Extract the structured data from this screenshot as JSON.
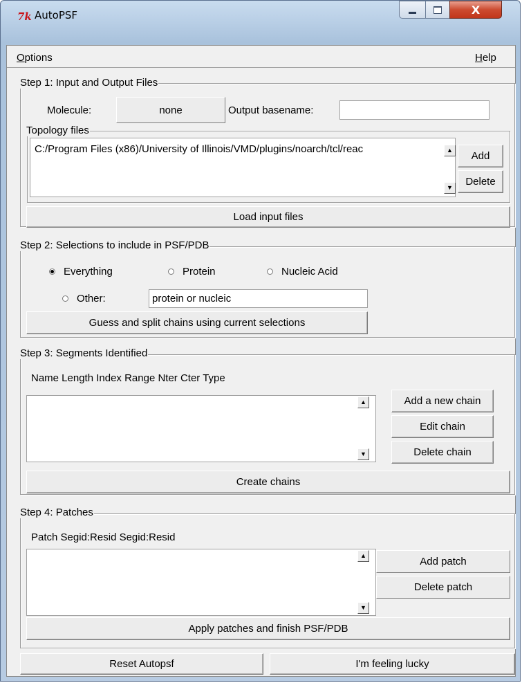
{
  "window": {
    "title": "AutoPSF",
    "icon_symbol": "7k",
    "close_glyph": "X"
  },
  "menu": {
    "options_underline": "O",
    "options_rest": "ptions",
    "help_underline": "H",
    "help_rest": "elp"
  },
  "step1": {
    "title": "Step 1: Input and Output Files",
    "molecule_label": "Molecule:",
    "molecule_value": "none",
    "output_label": "Output basename:",
    "output_value": "",
    "topology_title": "Topology files",
    "topology_files": [
      "C:/Program Files (x86)/University of Illinois/VMD/plugins/noarch/tcl/reac"
    ],
    "add_label": "Add",
    "delete_label": "Delete",
    "load_label": "Load input files"
  },
  "step2": {
    "title": "Step 2: Selections to include in PSF/PDB",
    "radio_everything": "Everything",
    "radio_protein": "Protein",
    "radio_nucleic": "Nucleic Acid",
    "radio_other": "Other:",
    "selected": "Everything",
    "other_value": "protein or nucleic",
    "guess_label": "Guess and split chains using current selections"
  },
  "step3": {
    "title": "Step 3: Segments Identified",
    "columns": "Name Length  Index  Range Nter Cter Type",
    "add_chain_label": "Add a new chain",
    "edit_chain_label": "Edit chain",
    "delete_chain_label": "Delete chain",
    "create_label": "Create chains"
  },
  "step4": {
    "title": "Step 4: Patches",
    "columns": "Patch  Segid:Resid  Segid:Resid",
    "add_patch_label": "Add patch",
    "delete_patch_label": "Delete patch",
    "apply_label": "Apply patches and finish PSF/PDB"
  },
  "bottom": {
    "reset_label": "Reset Autopsf",
    "lucky_label": "I'm feeling lucky"
  }
}
